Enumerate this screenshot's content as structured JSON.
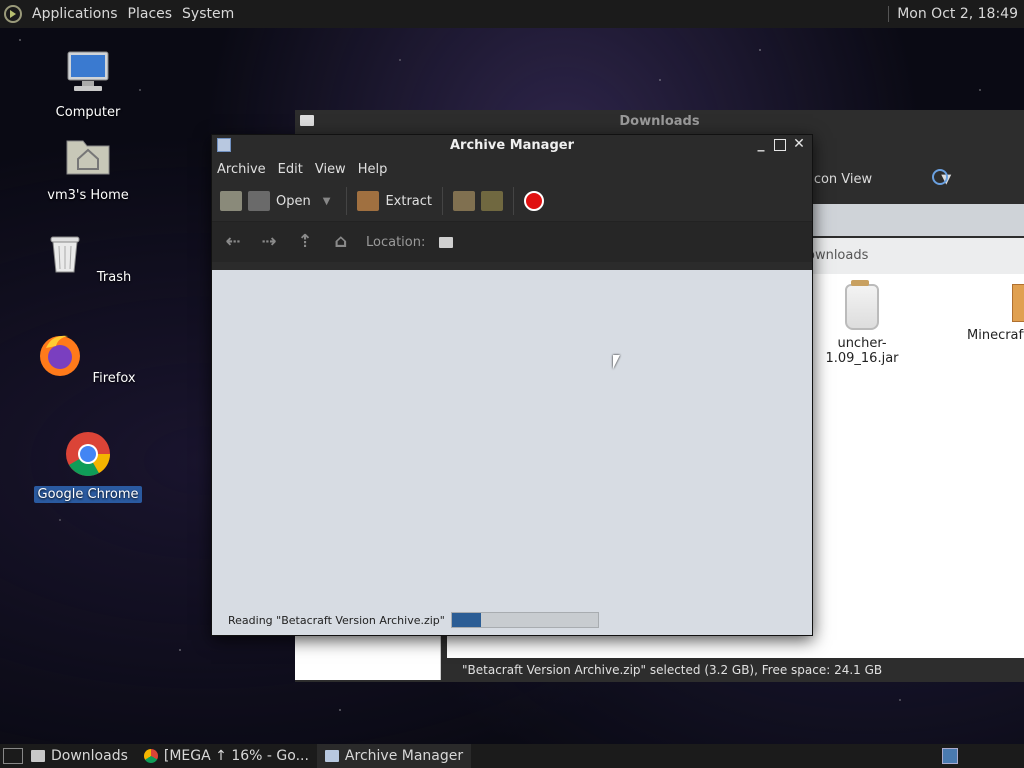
{
  "top_panel": {
    "menus": [
      "Applications",
      "Places",
      "System"
    ],
    "clock": "Mon Oct  2, 18:49"
  },
  "desktop_icons": [
    {
      "label": "Computer",
      "icon": "computer-icon"
    },
    {
      "label": "vm3's Home",
      "icon": "home-folder-icon"
    },
    {
      "label": "Trash",
      "icon": "trash-icon"
    },
    {
      "label": "Firefox",
      "icon": "firefox-icon"
    },
    {
      "label": "Google Chrome",
      "icon": "chrome-icon",
      "selected": true
    }
  ],
  "downloads_window": {
    "title": "Downloads",
    "view_mode": "Icon View",
    "path_label": "ownloads",
    "files": [
      {
        "name": "uncher-1.09_16.jar",
        "icon": "jar-icon"
      },
      {
        "name": "Minecraft",
        "icon": "package-icon"
      }
    ],
    "status": "\"Betacraft Version Archive.zip\" selected (3.2 GB), Free space: 24.1 GB"
  },
  "archive_manager": {
    "title": "Archive Manager",
    "menu": [
      "Archive",
      "Edit",
      "View",
      "Help"
    ],
    "toolbar": {
      "open_label": "Open",
      "extract_label": "Extract"
    },
    "location_label": "Location:",
    "status_text": "Reading \"Betacraft Version Archive.zip\"",
    "progress": 0.2
  },
  "taskbar": {
    "items": [
      {
        "label": "Downloads",
        "icon": "folder-icon"
      },
      {
        "label": "[MEGA ↑ 16% - Go...",
        "icon": "chrome-icon"
      },
      {
        "label": "Archive Manager",
        "icon": "archive-icon"
      }
    ]
  }
}
